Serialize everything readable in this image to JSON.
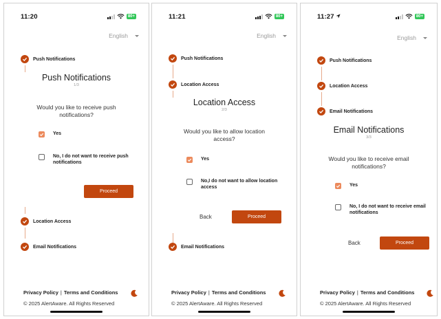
{
  "colors": {
    "accent": "#c2470f",
    "checkbox_checked": "#ec8a5c",
    "connector": "#e7a98a",
    "battery": "#32c759"
  },
  "language": "English",
  "footer": {
    "privacy": "Privacy Policy",
    "separator": "|",
    "terms": "Terms and Conditions",
    "copyright": "© 2025 AlertAware. All Rights Reserved"
  },
  "battery_text": "80+",
  "screens": [
    {
      "time": "11:20",
      "steps": [
        "Push Notifications",
        "Location Access",
        "Email Notifications"
      ],
      "title": "Push Notifications",
      "step_count": "1/3",
      "question": "Would you like to receive push notifications?",
      "options": [
        {
          "label": "Yes",
          "checked": true
        },
        {
          "label": "No, I do not want to receive push notifications",
          "checked": false
        }
      ],
      "proceed": "Proceed"
    },
    {
      "time": "11:21",
      "steps": [
        "Push Notifications",
        "Location Access",
        "Email Notifications"
      ],
      "title": "Location Access",
      "step_count": "2/3",
      "question": "Would you like to allow location access?",
      "options": [
        {
          "label": "Yes",
          "checked": true
        },
        {
          "label": "No,I do not want to allow location access",
          "checked": false
        }
      ],
      "back": "Back",
      "proceed": "Proceed"
    },
    {
      "time": "11:27",
      "steps": [
        "Push Notifications",
        "Location Access",
        "Email Notifications"
      ],
      "title": "Email Notifications",
      "step_count": "3/3",
      "question": "Would you like to receive email notifications?",
      "options": [
        {
          "label": "Yes",
          "checked": true
        },
        {
          "label": "No, I do not want to receive email notifications",
          "checked": false
        }
      ],
      "back": "Back",
      "proceed": "Proceed"
    }
  ]
}
